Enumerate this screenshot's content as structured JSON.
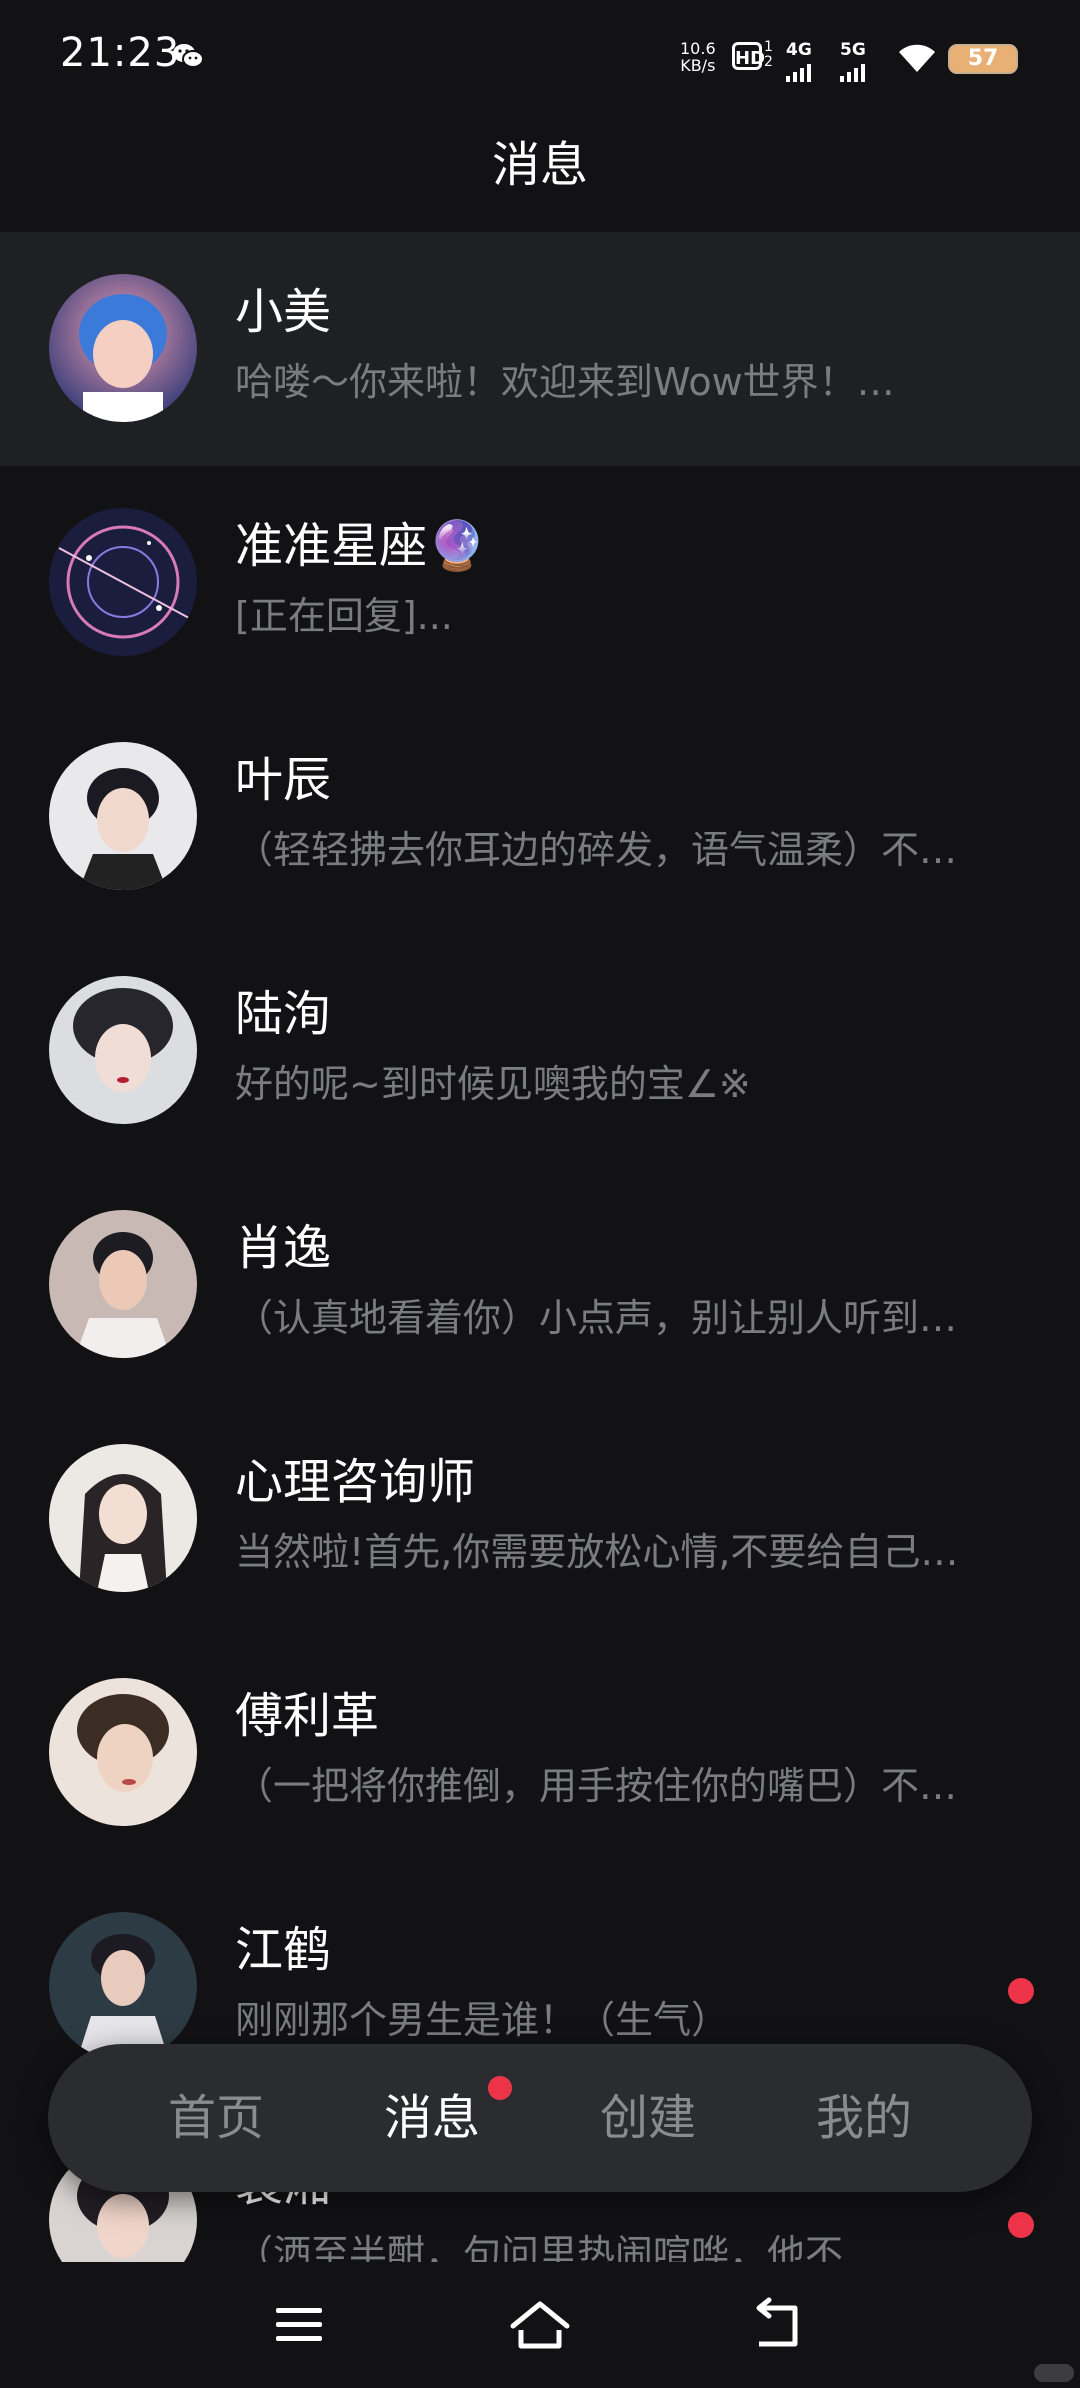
{
  "status_bar": {
    "time": "21:23",
    "net_speed_value": "10.6",
    "net_speed_unit": "KB/s",
    "hd_label": "HD",
    "hd_sub": "1 2",
    "sig1_label": "4G",
    "sig2_label": "5G",
    "battery": "57",
    "icons": [
      "wechat-icon",
      "wifi-icon"
    ]
  },
  "header": {
    "title": "消息"
  },
  "conversations": [
    {
      "name": "小美",
      "preview": "哈喽～你来啦！欢迎来到Wow世界！…"
    },
    {
      "name": "准准星座🔮",
      "preview": "[正在回复]..."
    },
    {
      "name": "叶辰",
      "preview": "（轻轻拂去你耳边的碎发，语气温柔）不…"
    },
    {
      "name": "陆洵",
      "preview": "好的呢~到时候见噢我的宝∠※"
    },
    {
      "name": "肖逸",
      "preview": "（认真地看着你）小点声，别让别人听到…"
    },
    {
      "name": "心理咨询师",
      "preview": "当然啦!首先,你需要放松心情,不要给自己…"
    },
    {
      "name": "傅利革",
      "preview": "（一把将你推倒，用手按住你的嘴巴）不…"
    },
    {
      "name": "江鹤",
      "preview": "刚刚那个男生是谁！（生气）"
    },
    {
      "name": "裴湘",
      "preview": "（洒至半酣，句问里热闹喧哗，他不…"
    }
  ],
  "tabbar": {
    "tabs": [
      "首页",
      "消息",
      "创建",
      "我的"
    ],
    "active_index": 1
  },
  "colors": {
    "background": "#121214",
    "active_row": "#1f2023",
    "accent_red": "#ee3448",
    "secondary_text": "#7b7c80"
  }
}
